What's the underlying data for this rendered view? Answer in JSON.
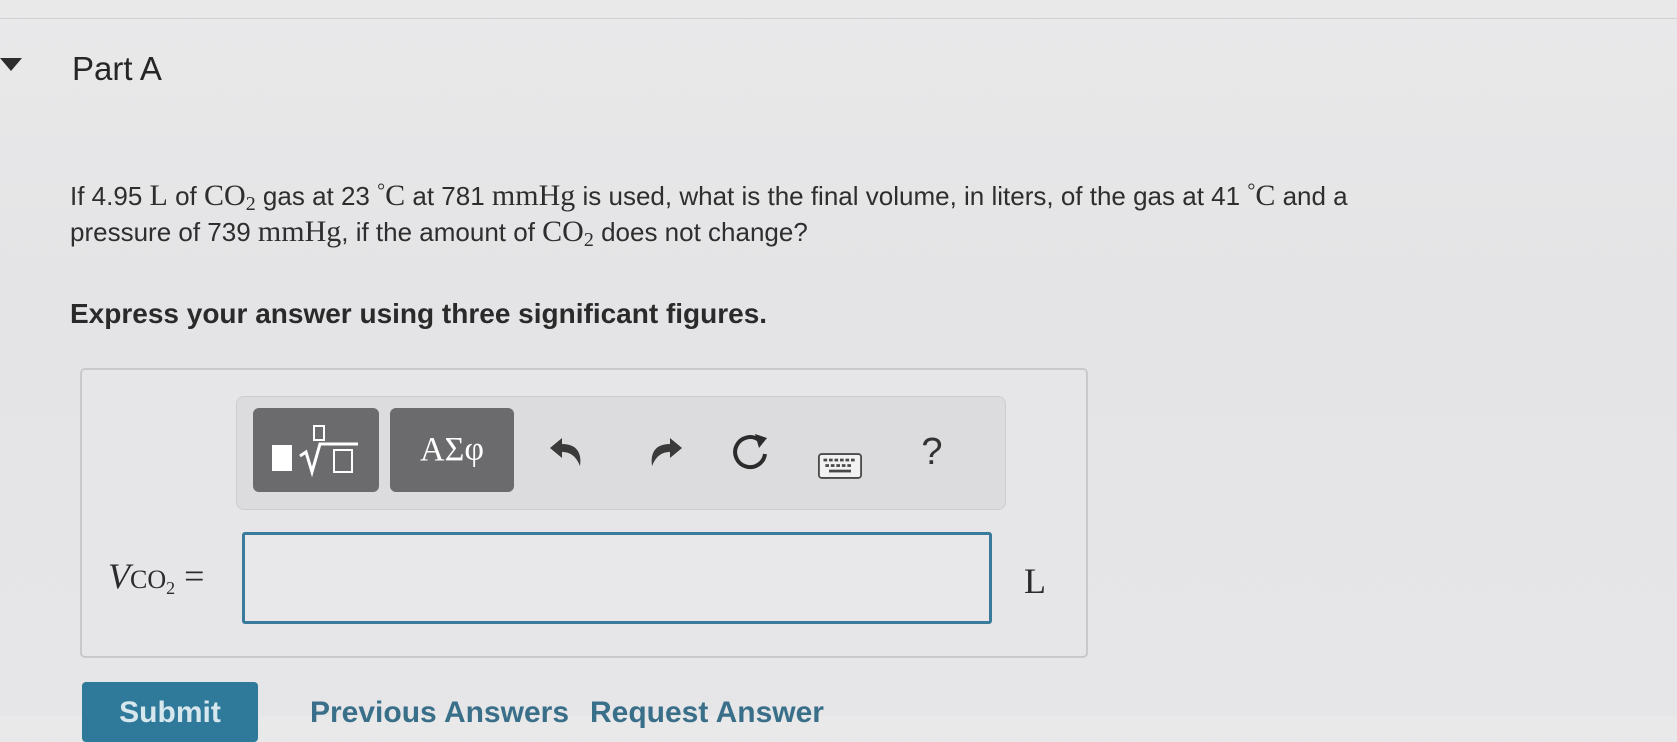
{
  "part": {
    "title": "Part A"
  },
  "question": {
    "p1": "If 4.95",
    "l_unit": "L",
    "p2": "of",
    "co2": "CO",
    "sub2": "2",
    "p3": "gas at 23",
    "deg": "°",
    "c_unit": "C",
    "p4": "at 781",
    "mmhg": "mmHg",
    "p5": "is used, what is the final volume, in liters, of the gas at 41",
    "p6": "and a",
    "p7": "pressure of 739",
    "p8": ", if the amount of",
    "p9": "does not change?"
  },
  "instruction": "Express your answer using three significant figures.",
  "toolbar": {
    "greek_label": "ΑΣφ",
    "help_label": "?",
    "icons": [
      "templates-icon",
      "undo-icon",
      "redo-icon",
      "reset-icon",
      "keyboard-icon",
      "help-icon"
    ]
  },
  "answer": {
    "var_main": "V",
    "var_sub": "CO",
    "var_sub2": "2",
    "equals": "=",
    "value": "",
    "unit": "L"
  },
  "actions": {
    "submit": "Submit",
    "previous": "Previous Answers",
    "request": "Request Answer"
  },
  "colors": {
    "accent": "#2f7a9a",
    "input_border": "#3a7a9a",
    "tool_button": "#6b6b6e"
  }
}
